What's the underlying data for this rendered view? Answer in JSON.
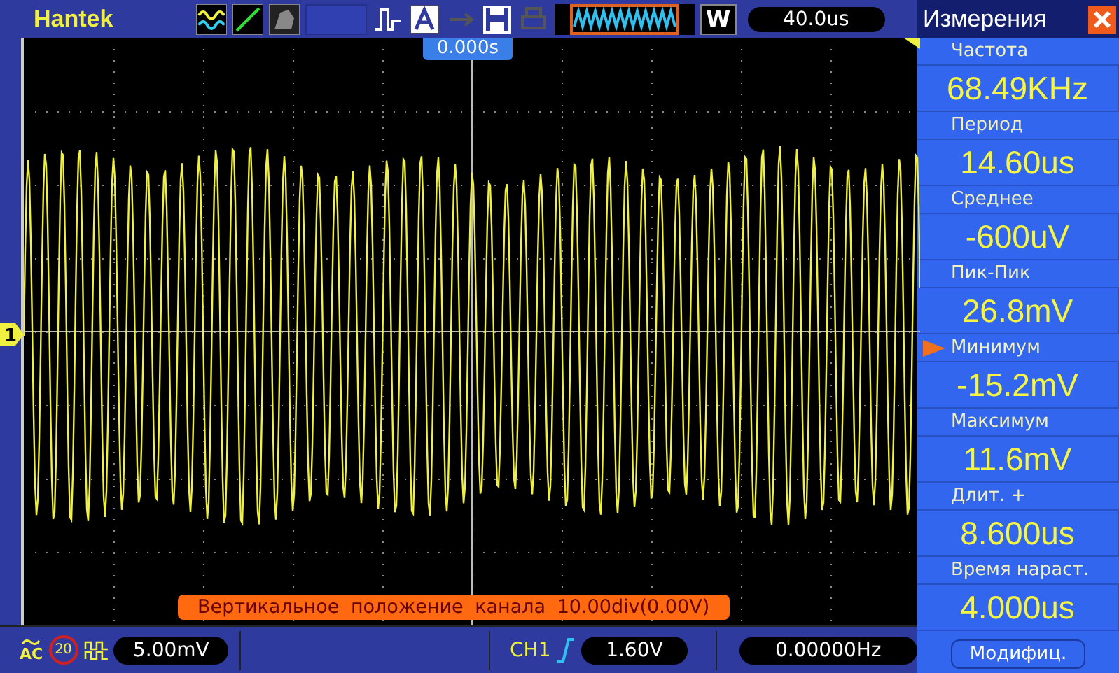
{
  "top_bar": {
    "logo": "Hantek",
    "run_mode": "W",
    "timebase": "40.0us"
  },
  "trigger_position": "0.000s",
  "channel_marker": "1",
  "message": "Вертикальное положение канала 10.00div(0.00V)",
  "bottom_bar": {
    "coupling": "AC",
    "bandwidth_limit": "20",
    "volts_per_div": "5.00mV",
    "trigger_source": "CH1",
    "trigger_level": "1.60V",
    "trigger_frequency": "0.00000Hz"
  },
  "measurements_panel": {
    "title": "Измерения",
    "items": [
      {
        "label": "Частота",
        "value": "68.49KHz",
        "selected": false
      },
      {
        "label": "Период",
        "value": "14.60us",
        "selected": false
      },
      {
        "label": "Среднее",
        "value": "-600uV",
        "selected": false
      },
      {
        "label": "Пик-Пик",
        "value": "26.8mV",
        "selected": false
      },
      {
        "label": "Минимум",
        "value": "-15.2mV",
        "selected": true
      },
      {
        "label": "Максимум",
        "value": "11.6mV",
        "selected": false
      },
      {
        "label": "Длит. +",
        "value": "8.600us",
        "selected": false
      },
      {
        "label": "Время нараст.",
        "value": "4.000us",
        "selected": false
      }
    ],
    "button": "Модифиц."
  }
}
